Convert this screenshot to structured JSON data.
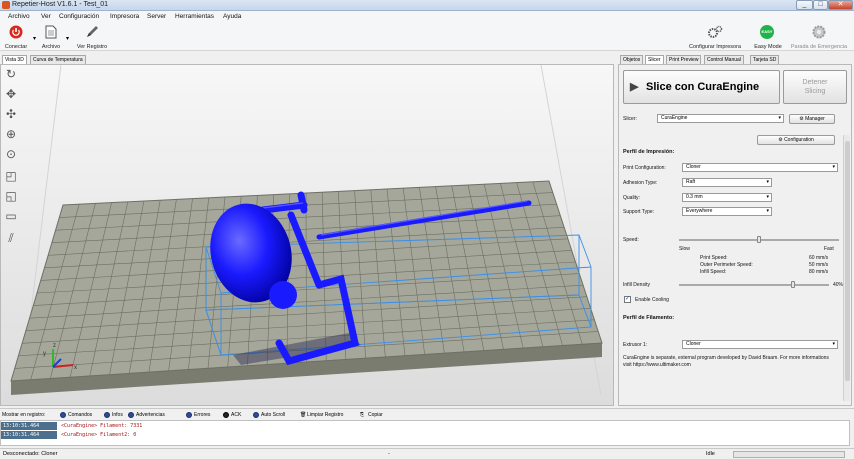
{
  "window": {
    "title": "Repetier-Host V1.6.1 - Test_01",
    "min": "_",
    "max": "□",
    "close": "✕"
  },
  "menu": [
    "Archivo",
    "Ver",
    "Configuración",
    "Impresora",
    "Server",
    "Herramientas",
    "Ayuda"
  ],
  "toolbar": {
    "connect": "Conectar",
    "file": "Archivo",
    "view_log": "Ver Registro",
    "config_printer": "Configurar Impresora",
    "easy_mode": "Easy Mode",
    "easy_badge": "EASY",
    "emergency": "Parada de Emergencia"
  },
  "viewer_tabs": [
    "Vista 3D",
    "Curva de Temperatura"
  ],
  "right_tabs": [
    "Objetos",
    "Slicer",
    "Print Preview",
    "Control Manual",
    "Tarjeta SD"
  ],
  "slicer": {
    "slice_button": "Slice con CuraEngine",
    "stop_button_line1": "Detener",
    "stop_button_line2": "Slicing",
    "slicer_label": "Slicer:",
    "slicer_value": "CuraEngine",
    "manager_button": "Manager",
    "configuration_button": "Configuration",
    "print_profile_heading": "Perfil de Impresión:",
    "print_config_label": "Print Configuration:",
    "print_config_value": "Cloner",
    "adhesion_label": "Adhesion Type:",
    "adhesion_value": "Raft",
    "quality_label": "Quality:",
    "quality_value": "0.3 mm",
    "support_label": "Support Type:",
    "support_value": "Everywhere",
    "speed_label": "Speed:",
    "speed_slow": "Slow",
    "speed_fast": "Fast",
    "speed_level": 0.5,
    "print_speed_label": "Print Speed:",
    "print_speed_value": "60 mm/s",
    "outer_speed_label": "Outer Perimeter Speed:",
    "outer_speed_value": "50 mm/s",
    "infill_speed_label": "Infill Speed:",
    "infill_speed_value": "80 mm/s",
    "infill_density_label": "Infill Density",
    "infill_density_value": "40%",
    "infill_level": 0.4,
    "enable_cooling_label": "Enable Cooling",
    "filament_heading": "Perfil de Filamento:",
    "extruder_label": "Extrusor 1:",
    "extruder_value": "Cloner",
    "note": "CuraEngine is separate, external program developed by David Braam. For more informations visit https://www.ultimaker.com"
  },
  "logbar": {
    "show_label": "Mostrar en registro:",
    "commands": "Comandos",
    "infos": "Infos",
    "warnings": "Advertencias",
    "errors": "Errores",
    "ack": "ACK",
    "autoscroll": "Auto Scroll",
    "clear": "Limpiar Registro",
    "copy": "Copiar"
  },
  "log": [
    {
      "time": "13:10:31.464",
      "msg": "<CuraEngine> Filament: 7331"
    },
    {
      "time": "13:10:31.464",
      "msg": "<CuraEngine> Filament2: 0"
    }
  ],
  "status": {
    "connection": "Desconectado: Cloner",
    "center": "-",
    "state": "Idle"
  },
  "colors": {
    "model": "#1a1aff",
    "bed_top": "#a5a79a",
    "bed_side": "#7b7c70",
    "accent": "#3173c9"
  }
}
